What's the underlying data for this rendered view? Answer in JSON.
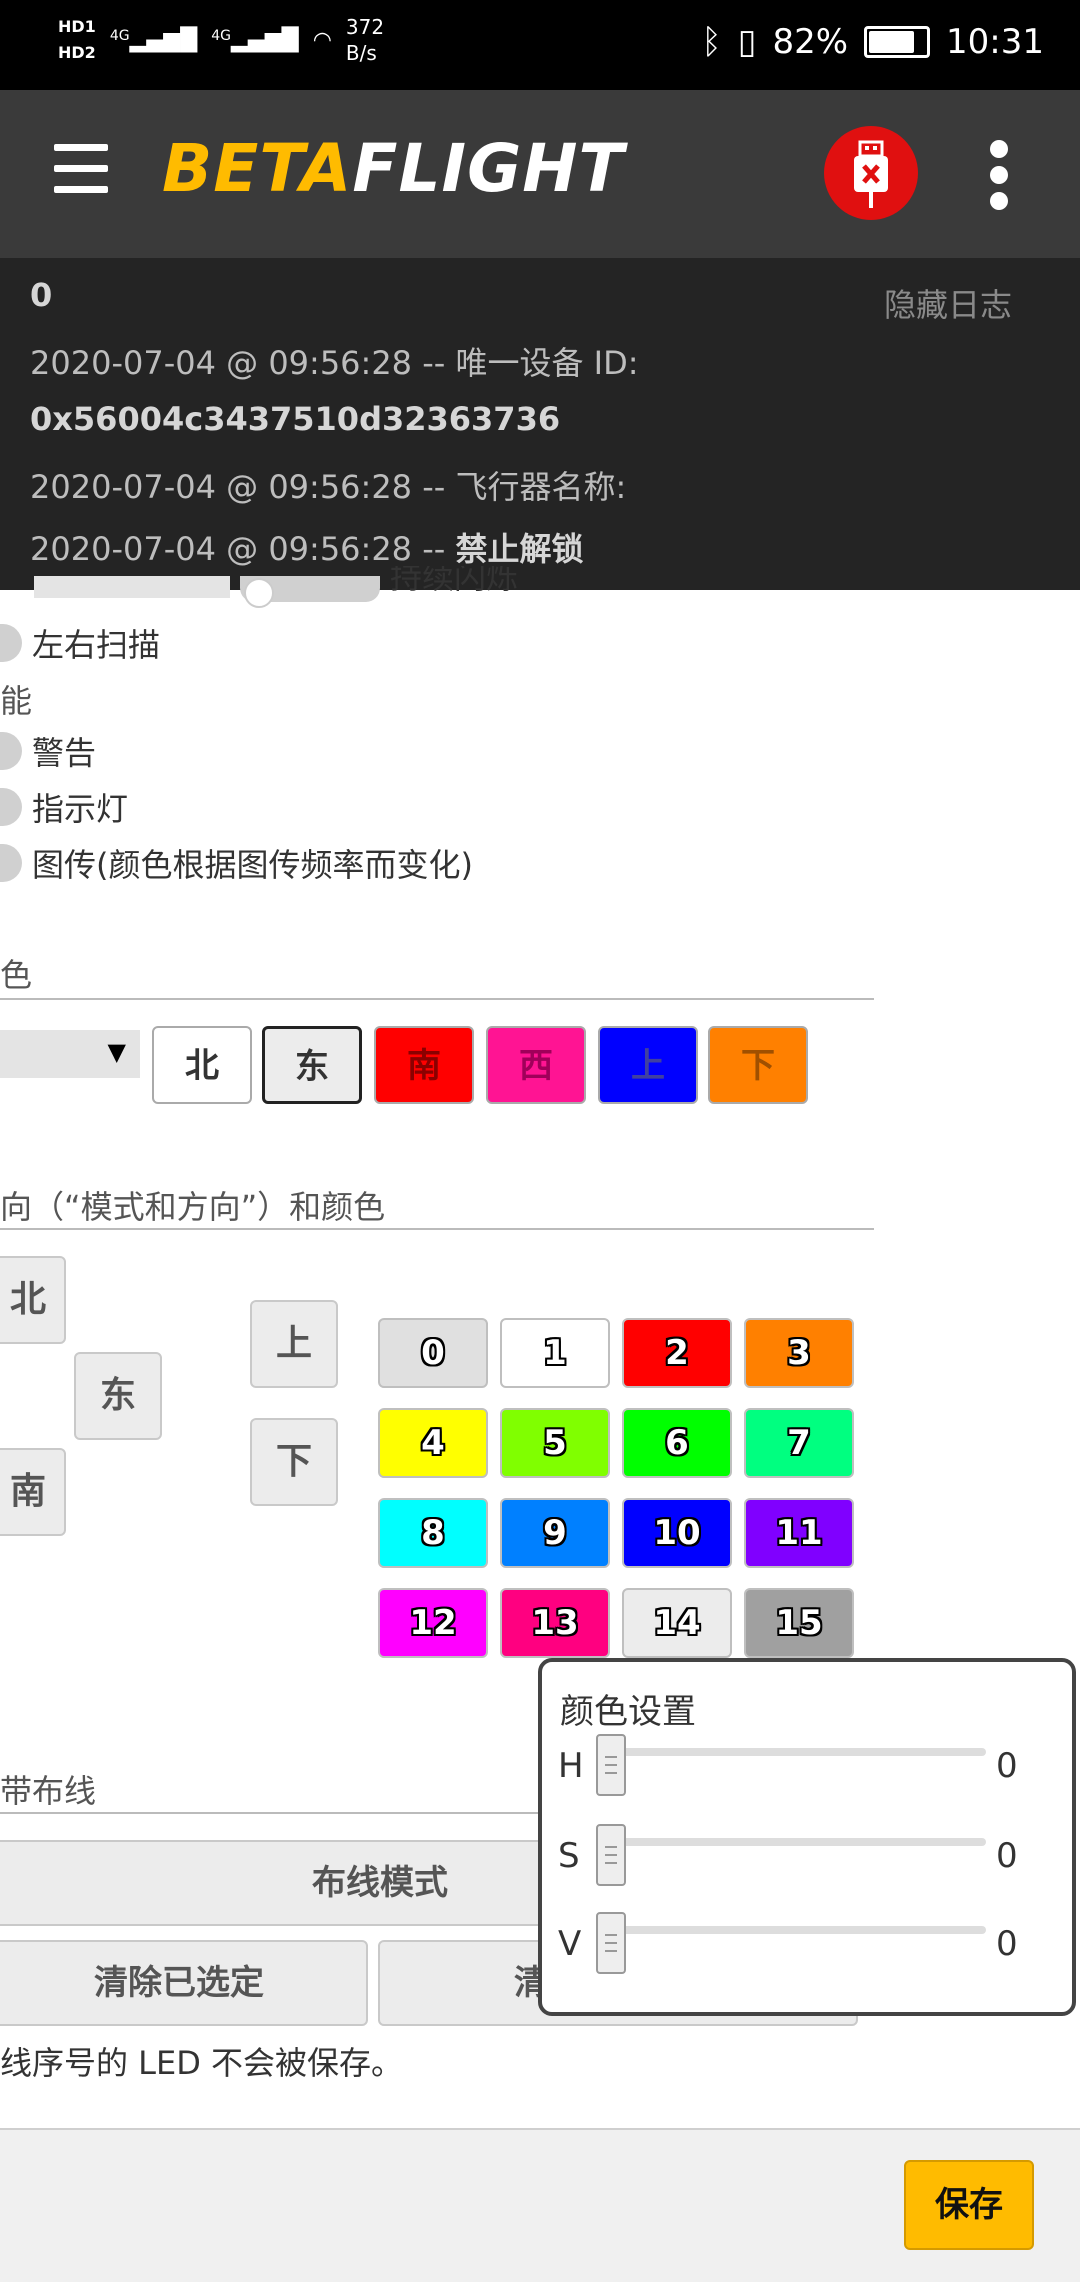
{
  "statusbar": {
    "hd1": "HD1",
    "hd2": "HD2",
    "net1": "4G",
    "net2": "4G",
    "speed_value": "372",
    "speed_unit": "B/s",
    "battery": "82%",
    "battery_level": 0.82,
    "time": "10:31"
  },
  "header": {
    "logo_beta": "BETA",
    "logo_flight": "FLIGHT",
    "colors": {
      "logo_yellow": "#ffbb00",
      "usb_red": "#e01010",
      "bar": "#3a3a3a"
    }
  },
  "log": {
    "hide_label": "隐藏日志",
    "lines": [
      {
        "prefix": "",
        "bold": "0"
      },
      {
        "prefix": "2020-07-04 @ 09:56:28 -- 唯一设备 ID:",
        "bold": ""
      },
      {
        "prefix": "",
        "bold": "0x56004c3437510d32363736"
      },
      {
        "prefix": "2020-07-04 @ 09:56:28 -- 飞行器名称:",
        "bold": ""
      },
      {
        "prefix": "2020-07-04 @ 09:56:28 -- ",
        "bold": "禁止解锁"
      }
    ]
  },
  "functions": {
    "partial_top": "持续闪烁",
    "larson": "左右扫描",
    "section_label": "能",
    "items": [
      "警告",
      "指示灯",
      "图传(颜色根据图传频率而变化)"
    ]
  },
  "color_section": {
    "title": "色",
    "directions": [
      {
        "label": "北",
        "bg": "#ffffff",
        "fg": "#333333"
      },
      {
        "label": "东",
        "bg": "#ececec",
        "fg": "#333333"
      },
      {
        "label": "南",
        "bg": "#ff0000",
        "fg": "#8b0000"
      },
      {
        "label": "西",
        "bg": "#ff1493",
        "fg": "#a0005a"
      },
      {
        "label": "上",
        "bg": "#0000ff",
        "fg": "#4040a0"
      },
      {
        "label": "下",
        "bg": "#ff8000",
        "fg": "#a05000"
      }
    ]
  },
  "mode_section": {
    "title": "向（“模式和方向”）和颜色",
    "north": "北",
    "east": "东",
    "south": "南",
    "up": "上",
    "down": "下"
  },
  "palette": [
    {
      "label": "0",
      "bg": "#e0e0e0"
    },
    {
      "label": "1",
      "bg": "#ffffff"
    },
    {
      "label": "2",
      "bg": "#ff0000"
    },
    {
      "label": "3",
      "bg": "#ff8000"
    },
    {
      "label": "4",
      "bg": "#ffff00"
    },
    {
      "label": "5",
      "bg": "#80ff00"
    },
    {
      "label": "6",
      "bg": "#00ff00"
    },
    {
      "label": "7",
      "bg": "#00ff80"
    },
    {
      "label": "8",
      "bg": "#00ffff"
    },
    {
      "label": "9",
      "bg": "#0080ff"
    },
    {
      "label": "10",
      "bg": "#0000ff"
    },
    {
      "label": "11",
      "bg": "#8000ff"
    },
    {
      "label": "12",
      "bg": "#ff00ff"
    },
    {
      "label": "13",
      "bg": "#ff0080"
    },
    {
      "label": "14",
      "bg": "#ececec"
    },
    {
      "label": "15",
      "bg": "#a0a0a0"
    }
  ],
  "wiring": {
    "title": "带布线",
    "wire_mode": "布线模式",
    "clear_selected": "清除已选定",
    "clear_all_partial": "清",
    "note": "线序号的 LED 不会被保存。"
  },
  "color_popup": {
    "title": "颜色设置",
    "sliders": [
      {
        "label": "H",
        "value": "0"
      },
      {
        "label": "S",
        "value": "0"
      },
      {
        "label": "V",
        "value": "0"
      }
    ]
  },
  "footer": {
    "save": "保存"
  }
}
